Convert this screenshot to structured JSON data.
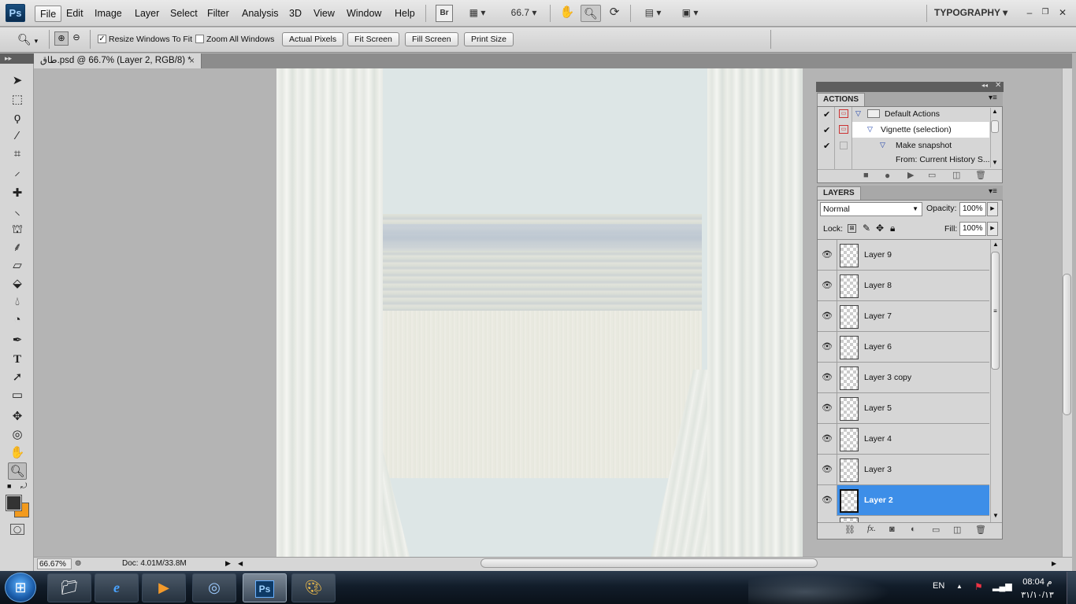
{
  "menubar": {
    "app_logo": "Ps",
    "menus": [
      "File",
      "Edit",
      "Image",
      "Layer",
      "Select",
      "Filter",
      "Analysis",
      "3D",
      "View",
      "Window",
      "Help"
    ],
    "bridge_label": "Br",
    "zoom_value": "66.7",
    "workspace": "TYPOGRAPHY"
  },
  "options_bar": {
    "resize_windows_to_fit": "Resize Windows To Fit",
    "resize_checked": true,
    "zoom_all_windows": "Zoom All Windows",
    "zoom_all_checked": false,
    "buttons": [
      "Actual Pixels",
      "Fit Screen",
      "Fill Screen",
      "Print Size"
    ]
  },
  "document": {
    "tab_title": "طاق.psd @ 66.7% (Layer 2, RGB/8) *",
    "close_glyph": "×"
  },
  "status_bar": {
    "zoom": "66.67%",
    "doc_size": "Doc: 4.01M/33.8M"
  },
  "actions_panel": {
    "tab": "ACTIONS",
    "rows": [
      {
        "label": "Default Actions",
        "checked": true
      },
      {
        "label": "Vignette (selection)",
        "checked": true
      },
      {
        "label": "Make snapshot",
        "checked": true
      },
      {
        "label": "From: Current History S...",
        "checked": false
      }
    ]
  },
  "layers_panel": {
    "tab": "LAYERS",
    "blend_mode": "Normal",
    "opacity_label": "Opacity:",
    "opacity_value": "100%",
    "lock_label": "Lock:",
    "fill_label": "Fill:",
    "fill_value": "100%",
    "layers": [
      "Layer 9",
      "Layer 8",
      "Layer 7",
      "Layer 6",
      "Layer 3 copy",
      "Layer 5",
      "Layer 4",
      "Layer 3",
      "Layer 2"
    ],
    "selected_layer": "Layer 2"
  },
  "taskbar": {
    "language": "EN",
    "time": "08:04 م",
    "date": "٣١/١٠/١٣"
  },
  "colors": {
    "selection_blue": "#3d8ee8",
    "foreground_swatch": "#333333",
    "background_swatch": "#f29a1d"
  }
}
